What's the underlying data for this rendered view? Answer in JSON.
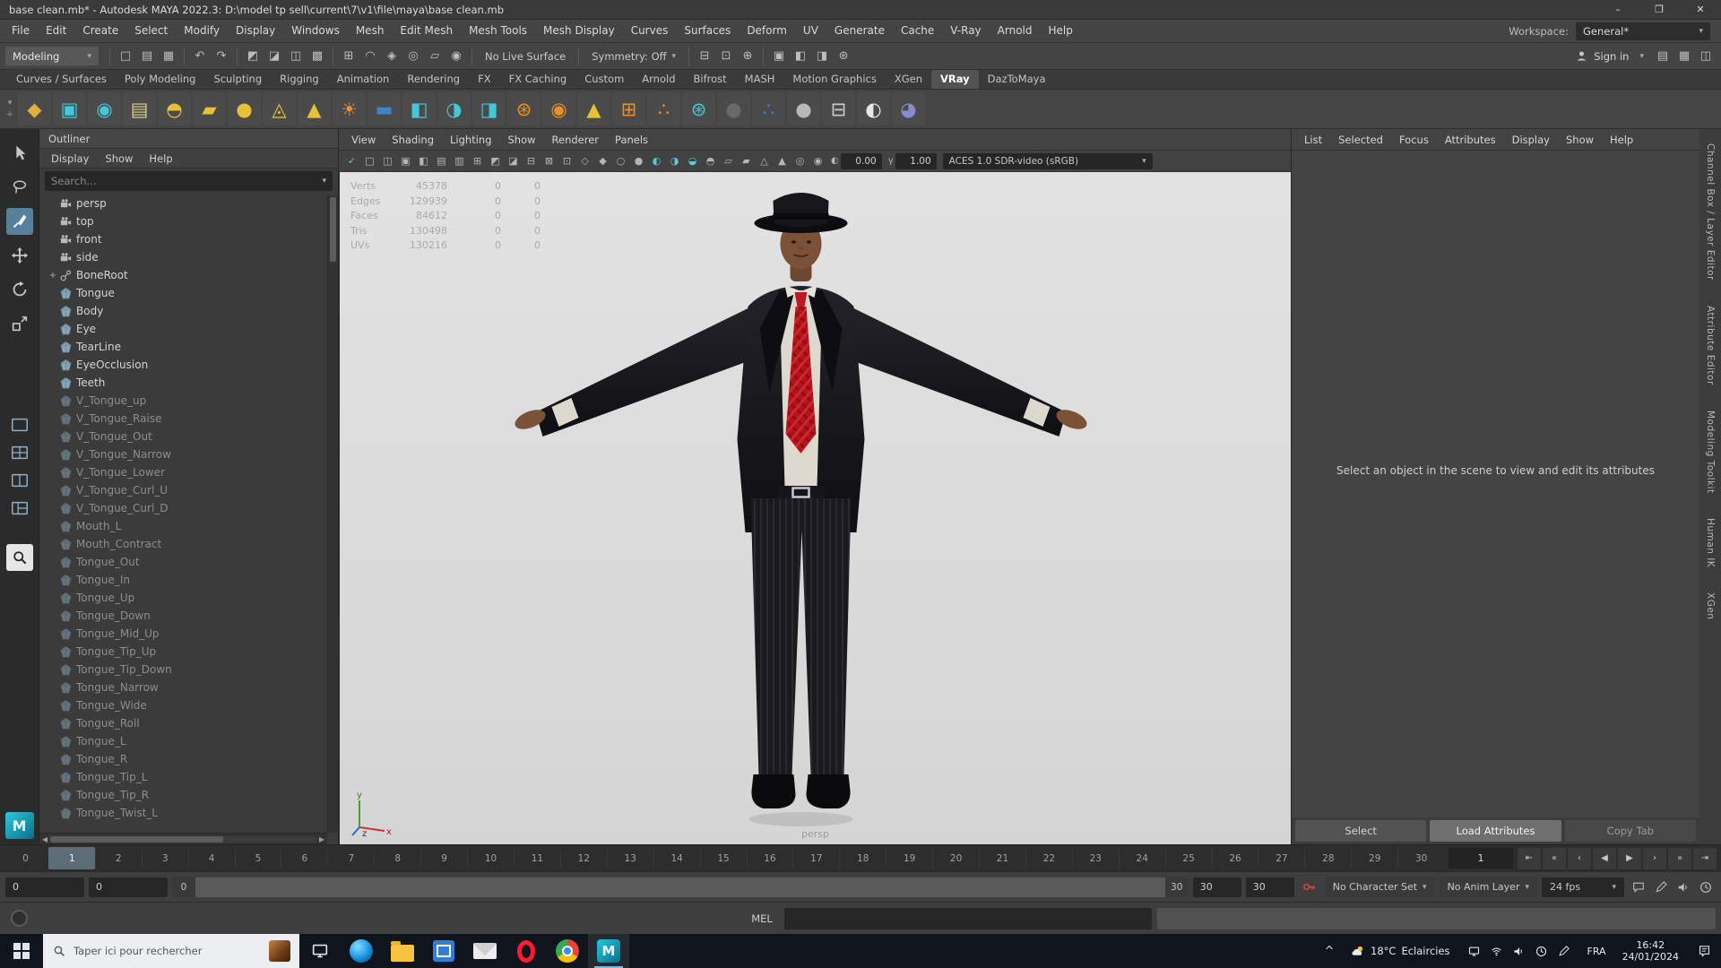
{
  "maya_logo_letter": "M",
  "glyphs": {
    "caret": "▾",
    "plus": "+",
    "left": "◀",
    "right": "▶"
  },
  "titlebar": {
    "title": "base clean.mb* - Autodesk MAYA 2022.3: D:\\model tp sell\\current\\7\\v1\\file\\maya\\base clean.mb",
    "minimize": "–",
    "maximize": "❐",
    "close": "✕"
  },
  "menubar": {
    "items": [
      "File",
      "Edit",
      "Create",
      "Select",
      "Modify",
      "Display",
      "Windows",
      "Mesh",
      "Edit Mesh",
      "Mesh Tools",
      "Mesh Display",
      "Curves",
      "Surfaces",
      "Deform",
      "UV",
      "Generate",
      "Cache",
      "V-Ray",
      "Arnold",
      "Help"
    ],
    "workspace_label": "Workspace:",
    "workspace_value": "General*"
  },
  "statusline": {
    "mode": "Modeling",
    "live_surface": "No Live Surface",
    "symmetry": "Symmetry: Off",
    "sign_in": "Sign in",
    "g1": [
      {
        "name": "new-scene-icon",
        "glyph": "□"
      },
      {
        "name": "open-scene-icon",
        "glyph": "▤"
      },
      {
        "name": "save-scene-icon",
        "glyph": "▦"
      }
    ],
    "g2": [
      {
        "name": "undo-icon",
        "glyph": "↶"
      },
      {
        "name": "redo-icon",
        "glyph": "↷"
      }
    ],
    "g3": [
      {
        "name": "select-by-hierarchy-icon",
        "glyph": "◩"
      },
      {
        "name": "select-by-object-icon",
        "glyph": "◪"
      },
      {
        "name": "select-by-component-icon",
        "glyph": "◫"
      },
      {
        "name": "highlight-selection-icon",
        "glyph": "▩"
      }
    ],
    "g4": [
      {
        "name": "snap-to-grid-icon",
        "glyph": "⊞"
      },
      {
        "name": "snap-to-curve-icon",
        "glyph": "◠"
      },
      {
        "name": "snap-to-point-icon",
        "glyph": "◈"
      },
      {
        "name": "snap-to-projected-center-icon",
        "glyph": "◎"
      },
      {
        "name": "snap-to-view-plane-icon",
        "glyph": "▱"
      },
      {
        "name": "make-live-icon",
        "glyph": "◉"
      }
    ],
    "g5": [
      {
        "name": "input-connections-icon",
        "glyph": "⊟"
      },
      {
        "name": "output-connections-icon",
        "glyph": "⊡"
      },
      {
        "name": "construction-history-icon",
        "glyph": "⊕"
      }
    ],
    "g6": [
      {
        "name": "open-render-view-icon",
        "glyph": "▣"
      },
      {
        "name": "render-current-frame-icon",
        "glyph": "◧"
      },
      {
        "name": "ipr-render-icon",
        "glyph": "◨"
      },
      {
        "name": "render-settings-icon",
        "glyph": "⊛"
      }
    ],
    "g7": [
      {
        "name": "channel-box-toggle-icon",
        "glyph": "▤"
      },
      {
        "name": "attribute-editor-toggle-icon",
        "glyph": "▦"
      },
      {
        "name": "tool-settings-toggle-icon",
        "glyph": "◫"
      }
    ]
  },
  "shelf": {
    "tabs": [
      "Curves / Surfaces",
      "Poly Modeling",
      "Sculpting",
      "Rigging",
      "Animation",
      "Rendering",
      "FX",
      "FX Caching",
      "Custom",
      "Arnold",
      "Bifrost",
      "MASH",
      "Motion Graphics",
      "XGen",
      "VRay",
      "DazToMaya"
    ],
    "active_tab": "VRay",
    "menu_icons": [
      {
        "name": "shelf-menu-icon",
        "glyph": "▾"
      },
      {
        "name": "shelf-edit-icon",
        "glyph": "+"
      }
    ],
    "icons": [
      {
        "name": "vray-vrscene-export-icon",
        "glyph": "◆",
        "color": "#e0b23a"
      },
      {
        "name": "vray-proxy-export-icon",
        "glyph": "▣",
        "color": "#45c6da"
      },
      {
        "name": "vray-proxy-import-icon",
        "glyph": "◉",
        "color": "#45c6da"
      },
      {
        "name": "vray-scene-manager-icon",
        "glyph": "▤",
        "color": "#d8d08a"
      },
      {
        "name": "vray-dome-light-icon",
        "glyph": "◓",
        "color": "#e6c23a"
      },
      {
        "name": "vray-rect-light-icon",
        "glyph": "▰",
        "color": "#e6c23a"
      },
      {
        "name": "vray-sphere-light-icon",
        "glyph": "●",
        "color": "#e6c23a"
      },
      {
        "name": "vray-ies-light-icon",
        "glyph": "◬",
        "color": "#e6c23a"
      },
      {
        "name": "vray-mesh-light-icon",
        "glyph": "▲",
        "color": "#e6c23a"
      },
      {
        "name": "vray-sun-light-icon",
        "glyph": "☀",
        "color": "#e8922d"
      },
      {
        "name": "vray-sky-icon",
        "glyph": "▬",
        "color": "#3e84c8"
      },
      {
        "name": "vray-physical-camera-icon",
        "glyph": "◧",
        "color": "#45c6da"
      },
      {
        "name": "vray-dome-camera-icon",
        "glyph": "◑",
        "color": "#45c6da"
      },
      {
        "name": "vray-clipper-icon",
        "glyph": "◨",
        "color": "#45c6da"
      },
      {
        "name": "vray-fur-icon",
        "glyph": "⊛",
        "color": "#e8922d"
      },
      {
        "name": "vray-displacement-icon",
        "glyph": "◉",
        "color": "#e8922d"
      },
      {
        "name": "vray-mesh-export-icon",
        "glyph": "▲",
        "color": "#e6c23a"
      },
      {
        "name": "vray-instancer-icon",
        "glyph": "⊞",
        "color": "#e8922d"
      },
      {
        "name": "vray-metaball-icon",
        "glyph": "∴",
        "color": "#e8922d"
      },
      {
        "name": "vray-volume-grid-icon",
        "glyph": "⊛",
        "color": "#45c6da"
      },
      {
        "name": "vray-mtl-icon",
        "glyph": "●",
        "color": "#6a6a6a"
      },
      {
        "name": "vray-blend-mtl-icon",
        "glyph": "∴",
        "color": "#3e84c8"
      },
      {
        "name": "vray-car-paint-mtl-icon",
        "glyph": "●",
        "color": "#b8b8b8"
      },
      {
        "name": "vray-node-editor-icon",
        "glyph": "⊟",
        "color": "#cfcfcf"
      },
      {
        "name": "vray-toon-mtl-icon",
        "glyph": "◐",
        "color": "#e8e8e8"
      },
      {
        "name": "vray-denoiser-icon",
        "glyph": "◕",
        "color": "#8a8ad0"
      }
    ]
  },
  "toolbox": {
    "tools": [
      {
        "name": "select-tool",
        "icon": "arrow",
        "active": false
      },
      {
        "name": "lasso-tool",
        "icon": "lasso",
        "active": false
      },
      {
        "name": "paint-select-tool",
        "icon": "paint",
        "active": true
      },
      {
        "name": "move-tool",
        "icon": "move",
        "active": false
      },
      {
        "name": "rotate-tool",
        "icon": "rotate",
        "active": false
      },
      {
        "name": "scale-tool",
        "icon": "scale",
        "active": false
      }
    ],
    "layouts": [
      {
        "name": "layout-single-pane",
        "icon": "lay1"
      },
      {
        "name": "layout-four-pane",
        "icon": "lay2"
      },
      {
        "name": "layout-two-pane",
        "icon": "lay3"
      },
      {
        "name": "layout-outliner-persp",
        "icon": "lay4"
      }
    ],
    "zoom": {
      "name": "zoom-tool",
      "icon": "zoom"
    }
  },
  "outliner": {
    "title": "Outliner",
    "menus": [
      "Display",
      "Show",
      "Help"
    ],
    "search_placeholder": "Search...",
    "items": [
      {
        "label": "persp",
        "icon": "cam"
      },
      {
        "label": "top",
        "icon": "cam"
      },
      {
        "label": "front",
        "icon": "cam"
      },
      {
        "label": "side",
        "icon": "cam"
      },
      {
        "label": "BoneRoot",
        "icon": "joint",
        "expandable": true
      },
      {
        "label": "Tongue",
        "icon": "mesh"
      },
      {
        "label": "Body",
        "icon": "mesh"
      },
      {
        "label": "Eye",
        "icon": "mesh"
      },
      {
        "label": "TearLine",
        "icon": "mesh"
      },
      {
        "label": "EyeOcclusion",
        "icon": "mesh"
      },
      {
        "label": "Teeth",
        "icon": "mesh"
      },
      {
        "label": "V_Tongue_up",
        "icon": "mesh",
        "dim": true
      },
      {
        "label": "V_Tongue_Raise",
        "icon": "mesh",
        "dim": true
      },
      {
        "label": "V_Tongue_Out",
        "icon": "mesh",
        "dim": true
      },
      {
        "label": "V_Tongue_Narrow",
        "icon": "mesh",
        "dim": true
      },
      {
        "label": "V_Tongue_Lower",
        "icon": "mesh",
        "dim": true
      },
      {
        "label": "V_Tongue_Curl_U",
        "icon": "mesh",
        "dim": true
      },
      {
        "label": "V_Tongue_Curl_D",
        "icon": "mesh",
        "dim": true
      },
      {
        "label": "Mouth_L",
        "icon": "mesh",
        "dim": true
      },
      {
        "label": "Mouth_Contract",
        "icon": "mesh",
        "dim": true
      },
      {
        "label": "Tongue_Out",
        "icon": "mesh",
        "dim": true
      },
      {
        "label": "Tongue_In",
        "icon": "mesh",
        "dim": true
      },
      {
        "label": "Tongue_Up",
        "icon": "mesh",
        "dim": true
      },
      {
        "label": "Tongue_Down",
        "icon": "mesh",
        "dim": true
      },
      {
        "label": "Tongue_Mid_Up",
        "icon": "mesh",
        "dim": true
      },
      {
        "label": "Tongue_Tip_Up",
        "icon": "mesh",
        "dim": true
      },
      {
        "label": "Tongue_Tip_Down",
        "icon": "mesh",
        "dim": true
      },
      {
        "label": "Tongue_Narrow",
        "icon": "mesh",
        "dim": true
      },
      {
        "label": "Tongue_Wide",
        "icon": "mesh",
        "dim": true
      },
      {
        "label": "Tongue_Roll",
        "icon": "mesh",
        "dim": true
      },
      {
        "label": "Tongue_L",
        "icon": "mesh",
        "dim": true
      },
      {
        "label": "Tongue_R",
        "icon": "mesh",
        "dim": true
      },
      {
        "label": "Tongue_Tip_L",
        "icon": "mesh",
        "dim": true
      },
      {
        "label": "Tongue_Tip_R",
        "icon": "mesh",
        "dim": true
      },
      {
        "label": "Tongue_Twist_L",
        "icon": "mesh",
        "dim": true
      }
    ]
  },
  "viewport": {
    "menus": [
      "View",
      "Shading",
      "Lighting",
      "Show",
      "Renderer",
      "Panels"
    ],
    "icons": [
      {
        "name": "renderer-active-icon",
        "glyph": "✓",
        "teal": true
      },
      {
        "name": "select-camera-icon",
        "glyph": "□"
      },
      {
        "name": "lock-camera-icon",
        "glyph": "◫"
      },
      {
        "name": "camera-attributes-icon",
        "glyph": "▣"
      },
      {
        "name": "bookmark-icon",
        "glyph": "◧"
      },
      {
        "name": "image-plane-icon",
        "glyph": "▤"
      },
      {
        "name": "pan-zoom-icon",
        "glyph": "▥"
      },
      {
        "name": "grid-icon",
        "glyph": "⊞"
      },
      {
        "name": "film-gate-icon",
        "glyph": "◩"
      },
      {
        "name": "resolution-gate-icon",
        "glyph": "◪"
      },
      {
        "name": "gate-mask-icon",
        "glyph": "⊟"
      },
      {
        "name": "field-chart-icon",
        "glyph": "⊠"
      },
      {
        "name": "safe-action-icon",
        "glyph": "⊡"
      },
      {
        "name": "safe-title-icon",
        "glyph": "◇"
      },
      {
        "name": "hud-icon",
        "glyph": "◆"
      },
      {
        "name": "xray-icon",
        "glyph": "○"
      },
      {
        "name": "wireframe-icon",
        "glyph": "●"
      },
      {
        "name": "shaded-icon",
        "glyph": "◐",
        "teal": true
      },
      {
        "name": "textured-icon",
        "glyph": "◑",
        "teal": true
      },
      {
        "name": "use-all-lights-icon",
        "glyph": "◒",
        "teal": true
      },
      {
        "name": "shadows-icon",
        "glyph": "◓"
      },
      {
        "name": "ao-icon",
        "glyph": "▱"
      },
      {
        "name": "motion-blur-icon",
        "glyph": "▰"
      },
      {
        "name": "multisample-icon",
        "glyph": "△"
      },
      {
        "name": "dof-icon",
        "glyph": "▲"
      },
      {
        "name": "isolate-select-icon",
        "glyph": "◎"
      },
      {
        "name": "plugin-shading-icon",
        "glyph": "◉"
      }
    ],
    "exposure_icon": "◐",
    "gamma_icon": "γ",
    "exposure": "0.00",
    "gamma": "1.00",
    "colorspace": "ACES 1.0 SDR-video (sRGB)",
    "hud": {
      "rows": [
        [
          "Verts",
          "45378",
          "0",
          "0"
        ],
        [
          "Edges",
          "129939",
          "0",
          "0"
        ],
        [
          "Faces",
          "84612",
          "0",
          "0"
        ],
        [
          "Tris",
          "130498",
          "0",
          "0"
        ],
        [
          "UVs",
          "130216",
          "0",
          "0"
        ]
      ]
    },
    "camera_label": "persp",
    "axis": {
      "x": "x",
      "y": "y",
      "z": "z"
    }
  },
  "attribute_editor": {
    "menus": [
      "List",
      "Selected",
      "Focus",
      "Attributes",
      "Display",
      "Show",
      "Help"
    ],
    "message": "Select an object in the scene to view and edit its attributes",
    "buttons": [
      {
        "label": "Select",
        "name": "select-button"
      },
      {
        "label": "Load Attributes",
        "name": "load-attributes-button",
        "highlight": true
      },
      {
        "label": "Copy Tab",
        "name": "copy-tab-button",
        "dim": true
      }
    ]
  },
  "right_tabs": [
    "Channel Box / Layer Editor",
    "Attribute Editor",
    "Modeling Toolkit",
    "Human IK",
    "XGen"
  ],
  "timeline": {
    "start": 0,
    "end": 30,
    "current": 1,
    "current_display": "1",
    "transport": [
      {
        "name": "go-to-start-button",
        "glyph": "⇤"
      },
      {
        "name": "step-back-key-button",
        "glyph": "«"
      },
      {
        "name": "step-back-frame-button",
        "glyph": "‹"
      },
      {
        "name": "play-backwards-button",
        "glyph": "◀"
      },
      {
        "name": "play-forwards-button",
        "glyph": "▶"
      },
      {
        "name": "step-forward-frame-button",
        "glyph": "›"
      },
      {
        "name": "step-forward-key-button",
        "glyph": "»"
      },
      {
        "name": "go-to-end-button",
        "glyph": "⇥"
      }
    ]
  },
  "range": {
    "anim_start": "0",
    "playback_start": "0",
    "bar_start": "0",
    "bar_end": "30",
    "playback_end": "30",
    "anim_end": "30",
    "character_set": "No Character Set",
    "anim_layer": "No Anim Layer",
    "fps": "24 fps",
    "icons": [
      {
        "name": "anim-preferences-icon",
        "sym": "chat"
      },
      {
        "name": "playblast-icon",
        "sym": "pen"
      },
      {
        "name": "sound-icon",
        "sym": "speaker"
      },
      {
        "name": "metronome-icon",
        "sym": "clock"
      }
    ]
  },
  "command_line": {
    "label": "MEL"
  },
  "taskbar": {
    "search_placeholder": "Taper ici pour rechercher",
    "apps": [
      {
        "name": "task-view-button",
        "kind": "taskview"
      },
      {
        "name": "edge-app",
        "kind": "edge"
      },
      {
        "name": "file-explorer-app",
        "kind": "folder"
      },
      {
        "name": "store-app",
        "kind": "store"
      },
      {
        "name": "mail-app",
        "kind": "mail"
      },
      {
        "name": "opera-app",
        "kind": "opera"
      },
      {
        "name": "chrome-app",
        "kind": "chrome"
      },
      {
        "name": "maya-app",
        "kind": "maya",
        "active": true
      }
    ],
    "tray_chevron": "^",
    "weather_temp": "18°C",
    "weather_text": "Eclaircies",
    "tray_icons": [
      {
        "name": "tray-monitor-icon",
        "sym": "monitor"
      },
      {
        "name": "tray-wifi-icon",
        "sym": "wifi"
      },
      {
        "name": "tray-volume-icon",
        "sym": "speaker"
      },
      {
        "name": "tray-clock-icon",
        "sym": "clock"
      },
      {
        "name": "tray-pen-icon",
        "sym": "pen"
      }
    ],
    "lang": "FRA",
    "time": "16:42",
    "date": "24/01/2024"
  }
}
